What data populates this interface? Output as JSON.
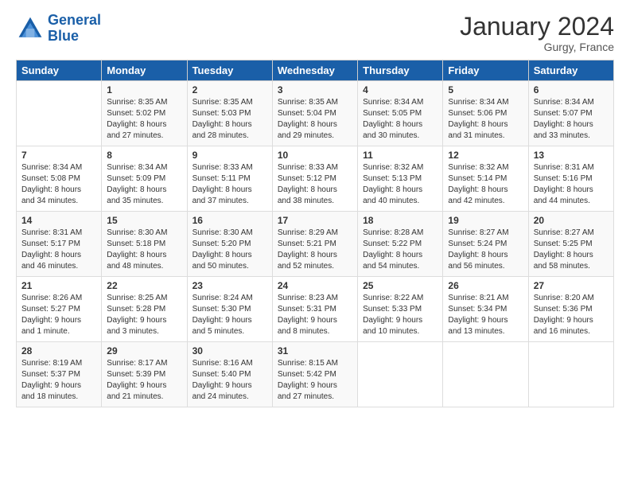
{
  "logo": {
    "line1": "General",
    "line2": "Blue"
  },
  "title": "January 2024",
  "location": "Gurgy, France",
  "days_header": [
    "Sunday",
    "Monday",
    "Tuesday",
    "Wednesday",
    "Thursday",
    "Friday",
    "Saturday"
  ],
  "weeks": [
    [
      {
        "num": "",
        "sunrise": "",
        "sunset": "",
        "daylight": ""
      },
      {
        "num": "1",
        "sunrise": "Sunrise: 8:35 AM",
        "sunset": "Sunset: 5:02 PM",
        "daylight": "Daylight: 8 hours and 27 minutes."
      },
      {
        "num": "2",
        "sunrise": "Sunrise: 8:35 AM",
        "sunset": "Sunset: 5:03 PM",
        "daylight": "Daylight: 8 hours and 28 minutes."
      },
      {
        "num": "3",
        "sunrise": "Sunrise: 8:35 AM",
        "sunset": "Sunset: 5:04 PM",
        "daylight": "Daylight: 8 hours and 29 minutes."
      },
      {
        "num": "4",
        "sunrise": "Sunrise: 8:34 AM",
        "sunset": "Sunset: 5:05 PM",
        "daylight": "Daylight: 8 hours and 30 minutes."
      },
      {
        "num": "5",
        "sunrise": "Sunrise: 8:34 AM",
        "sunset": "Sunset: 5:06 PM",
        "daylight": "Daylight: 8 hours and 31 minutes."
      },
      {
        "num": "6",
        "sunrise": "Sunrise: 8:34 AM",
        "sunset": "Sunset: 5:07 PM",
        "daylight": "Daylight: 8 hours and 33 minutes."
      }
    ],
    [
      {
        "num": "7",
        "sunrise": "Sunrise: 8:34 AM",
        "sunset": "Sunset: 5:08 PM",
        "daylight": "Daylight: 8 hours and 34 minutes."
      },
      {
        "num": "8",
        "sunrise": "Sunrise: 8:34 AM",
        "sunset": "Sunset: 5:09 PM",
        "daylight": "Daylight: 8 hours and 35 minutes."
      },
      {
        "num": "9",
        "sunrise": "Sunrise: 8:33 AM",
        "sunset": "Sunset: 5:11 PM",
        "daylight": "Daylight: 8 hours and 37 minutes."
      },
      {
        "num": "10",
        "sunrise": "Sunrise: 8:33 AM",
        "sunset": "Sunset: 5:12 PM",
        "daylight": "Daylight: 8 hours and 38 minutes."
      },
      {
        "num": "11",
        "sunrise": "Sunrise: 8:32 AM",
        "sunset": "Sunset: 5:13 PM",
        "daylight": "Daylight: 8 hours and 40 minutes."
      },
      {
        "num": "12",
        "sunrise": "Sunrise: 8:32 AM",
        "sunset": "Sunset: 5:14 PM",
        "daylight": "Daylight: 8 hours and 42 minutes."
      },
      {
        "num": "13",
        "sunrise": "Sunrise: 8:31 AM",
        "sunset": "Sunset: 5:16 PM",
        "daylight": "Daylight: 8 hours and 44 minutes."
      }
    ],
    [
      {
        "num": "14",
        "sunrise": "Sunrise: 8:31 AM",
        "sunset": "Sunset: 5:17 PM",
        "daylight": "Daylight: 8 hours and 46 minutes."
      },
      {
        "num": "15",
        "sunrise": "Sunrise: 8:30 AM",
        "sunset": "Sunset: 5:18 PM",
        "daylight": "Daylight: 8 hours and 48 minutes."
      },
      {
        "num": "16",
        "sunrise": "Sunrise: 8:30 AM",
        "sunset": "Sunset: 5:20 PM",
        "daylight": "Daylight: 8 hours and 50 minutes."
      },
      {
        "num": "17",
        "sunrise": "Sunrise: 8:29 AM",
        "sunset": "Sunset: 5:21 PM",
        "daylight": "Daylight: 8 hours and 52 minutes."
      },
      {
        "num": "18",
        "sunrise": "Sunrise: 8:28 AM",
        "sunset": "Sunset: 5:22 PM",
        "daylight": "Daylight: 8 hours and 54 minutes."
      },
      {
        "num": "19",
        "sunrise": "Sunrise: 8:27 AM",
        "sunset": "Sunset: 5:24 PM",
        "daylight": "Daylight: 8 hours and 56 minutes."
      },
      {
        "num": "20",
        "sunrise": "Sunrise: 8:27 AM",
        "sunset": "Sunset: 5:25 PM",
        "daylight": "Daylight: 8 hours and 58 minutes."
      }
    ],
    [
      {
        "num": "21",
        "sunrise": "Sunrise: 8:26 AM",
        "sunset": "Sunset: 5:27 PM",
        "daylight": "Daylight: 9 hours and 1 minute."
      },
      {
        "num": "22",
        "sunrise": "Sunrise: 8:25 AM",
        "sunset": "Sunset: 5:28 PM",
        "daylight": "Daylight: 9 hours and 3 minutes."
      },
      {
        "num": "23",
        "sunrise": "Sunrise: 8:24 AM",
        "sunset": "Sunset: 5:30 PM",
        "daylight": "Daylight: 9 hours and 5 minutes."
      },
      {
        "num": "24",
        "sunrise": "Sunrise: 8:23 AM",
        "sunset": "Sunset: 5:31 PM",
        "daylight": "Daylight: 9 hours and 8 minutes."
      },
      {
        "num": "25",
        "sunrise": "Sunrise: 8:22 AM",
        "sunset": "Sunset: 5:33 PM",
        "daylight": "Daylight: 9 hours and 10 minutes."
      },
      {
        "num": "26",
        "sunrise": "Sunrise: 8:21 AM",
        "sunset": "Sunset: 5:34 PM",
        "daylight": "Daylight: 9 hours and 13 minutes."
      },
      {
        "num": "27",
        "sunrise": "Sunrise: 8:20 AM",
        "sunset": "Sunset: 5:36 PM",
        "daylight": "Daylight: 9 hours and 16 minutes."
      }
    ],
    [
      {
        "num": "28",
        "sunrise": "Sunrise: 8:19 AM",
        "sunset": "Sunset: 5:37 PM",
        "daylight": "Daylight: 9 hours and 18 minutes."
      },
      {
        "num": "29",
        "sunrise": "Sunrise: 8:17 AM",
        "sunset": "Sunset: 5:39 PM",
        "daylight": "Daylight: 9 hours and 21 minutes."
      },
      {
        "num": "30",
        "sunrise": "Sunrise: 8:16 AM",
        "sunset": "Sunset: 5:40 PM",
        "daylight": "Daylight: 9 hours and 24 minutes."
      },
      {
        "num": "31",
        "sunrise": "Sunrise: 8:15 AM",
        "sunset": "Sunset: 5:42 PM",
        "daylight": "Daylight: 9 hours and 27 minutes."
      },
      {
        "num": "",
        "sunrise": "",
        "sunset": "",
        "daylight": ""
      },
      {
        "num": "",
        "sunrise": "",
        "sunset": "",
        "daylight": ""
      },
      {
        "num": "",
        "sunrise": "",
        "sunset": "",
        "daylight": ""
      }
    ]
  ]
}
